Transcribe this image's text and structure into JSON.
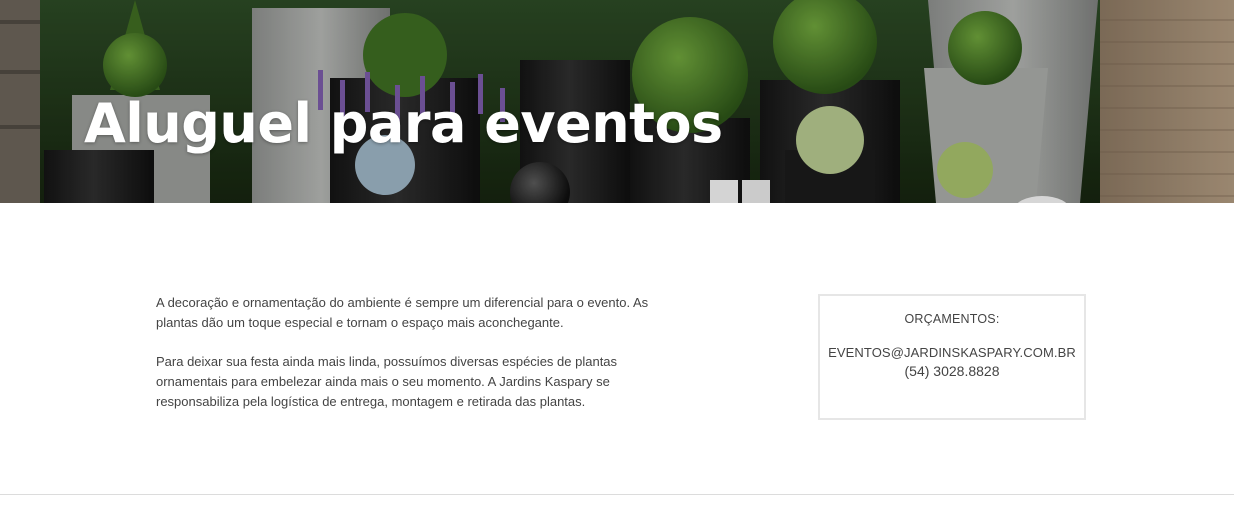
{
  "hero": {
    "title": "Aluguel para eventos"
  },
  "main": {
    "paragraphs": [
      "A decoração e ornamentação do ambiente é sempre um diferencial para o evento. As plantas dão um toque especial e tornam o espaço mais aconchegante.",
      "Para deixar sua festa ainda mais linda, possuímos diversas espécies de plantas ornamentais para embelezar ainda mais o seu momento.  A Jardins Kaspary se responsabiliza pela logística de entrega, montagem e retirada das plantas."
    ]
  },
  "quote_box": {
    "label": "ORÇAMENTOS:",
    "email": "EVENTOS@JARDINSKASPARY.COM.BR",
    "phone": "(54) 3028.8828"
  },
  "colors": {
    "text": "#444444",
    "box_border": "#e6e6e6",
    "hero_title": "#ffffff",
    "divider": "#dcdcdc"
  }
}
